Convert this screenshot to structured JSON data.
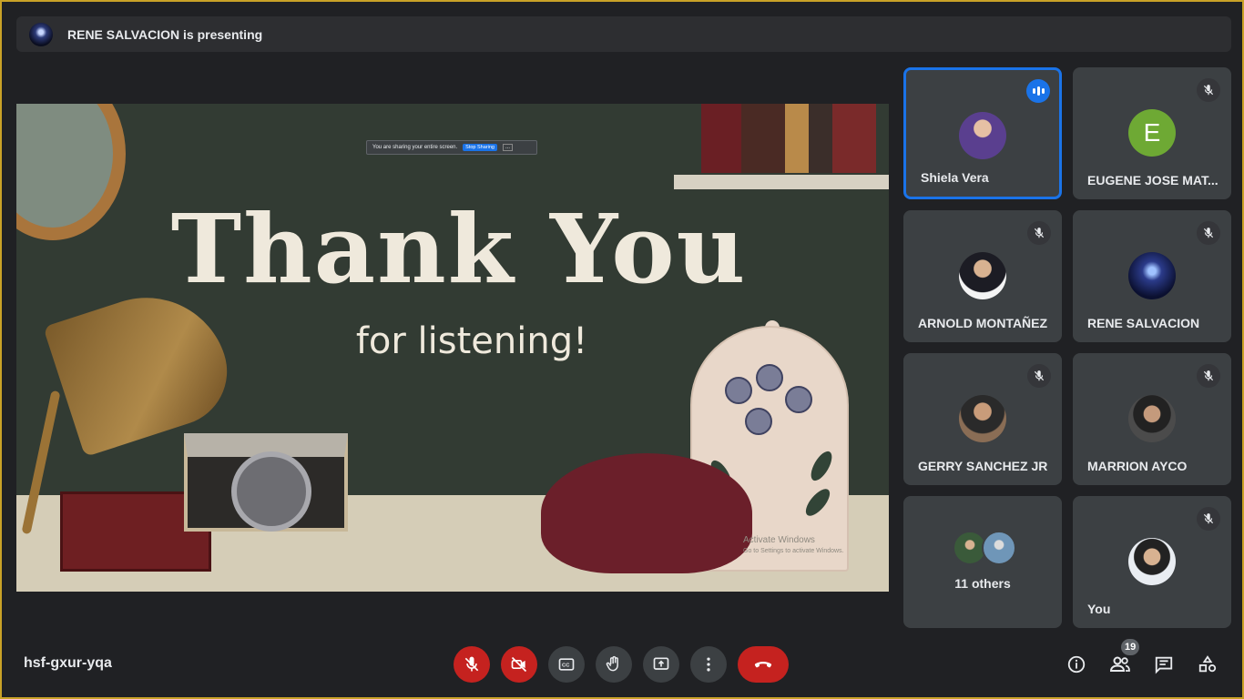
{
  "presenting_bar": {
    "text": "RENE SALVACION is presenting"
  },
  "slide": {
    "title": "Thank You",
    "subtitle": "for listening!",
    "share_notice": "You are sharing your entire screen.",
    "share_stop": "Stop Sharing",
    "share_more": "...",
    "watermark_title": "Activate Windows",
    "watermark_sub": "Go to Settings to activate Windows."
  },
  "participants": [
    {
      "name": "Shiela Vera",
      "speaking": true,
      "avatar_color": "#5a3f8f"
    },
    {
      "name": "EUGENE JOSE MAT...",
      "muted": true,
      "avatar_letter": "E",
      "avatar_color": "#6ea934"
    },
    {
      "name": "ARNOLD MONTAÑEZ",
      "muted": true,
      "avatar_color": "#f4f4f4"
    },
    {
      "name": "RENE SALVACION",
      "muted": true,
      "avatar_color": "#0b1030"
    },
    {
      "name": "GERRY SANCHEZ JR",
      "muted": true,
      "avatar_color": "#8a6d55"
    },
    {
      "name": "MARRION AYCO",
      "muted": true,
      "avatar_color": "#4b4b4b"
    },
    {
      "name": "11 others"
    },
    {
      "name": "You",
      "muted": true,
      "avatar_color": "#e9edf2"
    }
  ],
  "footer": {
    "meeting_code": "hsf-gxur-yqa",
    "people_count": "19"
  },
  "colors": {
    "background": "#202124",
    "tile": "#3c4043",
    "danger": "#c5221f",
    "accent": "#1a73e8"
  },
  "icons": {
    "mic": "mic-off-icon",
    "camera": "camera-off-icon",
    "captions": "captions-icon",
    "hand": "raise-hand-icon",
    "present": "present-screen-icon",
    "more": "more-options-icon",
    "end": "end-call-icon",
    "info": "info-icon",
    "people": "people-icon",
    "chat": "chat-icon",
    "activities": "activities-icon"
  }
}
